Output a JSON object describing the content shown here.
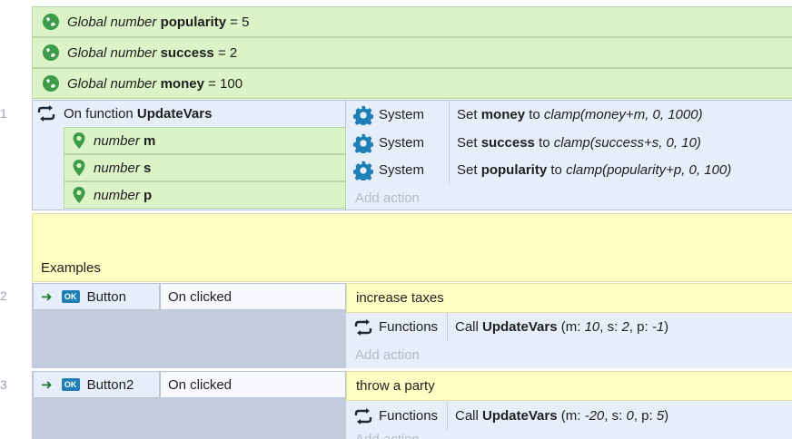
{
  "globals": [
    {
      "prefix": "Global number",
      "name": "popularity",
      "value": "= 5"
    },
    {
      "prefix": "Global number",
      "name": "success",
      "value": "= 2"
    },
    {
      "prefix": "Global number",
      "name": "money",
      "value": "= 100"
    }
  ],
  "line_numbers": [
    "1",
    "2",
    "3"
  ],
  "function_block": {
    "keyword": "On function",
    "name": "UpdateVars",
    "params": [
      {
        "type": "number",
        "name": "m"
      },
      {
        "type": "number",
        "name": "s"
      },
      {
        "type": "number",
        "name": "p"
      }
    ],
    "actions": [
      {
        "object": "System",
        "verb": "Set",
        "var": "money",
        "to": "to",
        "expr": "clamp(money+m, 0, 1000)"
      },
      {
        "object": "System",
        "verb": "Set",
        "var": "success",
        "to": "to",
        "expr": "clamp(success+s, 0, 10)"
      },
      {
        "object": "System",
        "verb": "Set",
        "var": "popularity",
        "to": "to",
        "expr": "clamp(popularity+p, 0, 100)"
      }
    ],
    "add_action": "Add action"
  },
  "comment_examples": "Examples",
  "events": [
    {
      "object": "Button",
      "trigger": "On clicked",
      "comment": "increase taxes",
      "action": {
        "object": "Functions",
        "call": "Call",
        "fn": "UpdateVars",
        "open": "(m:",
        "m": "10",
        "s_label": ", s:",
        "s": "2",
        "p_label": ", p:",
        "p": "-1",
        "close": ")"
      },
      "add_action": "Add action"
    },
    {
      "object": "Button2",
      "trigger": "On clicked",
      "comment": "throw a party",
      "action": {
        "object": "Functions",
        "call": "Call",
        "fn": "UpdateVars",
        "open": "(m:",
        "m": "-20",
        "s_label": ", s:",
        "s": "0",
        "p_label": ", p:",
        "p": "5",
        "close": ")"
      },
      "add_action": "Add action"
    }
  ],
  "colors": {
    "global_bg": "#dcf2c7",
    "event_bg": "#e6eef9",
    "comment_bg": "#ffffc4",
    "gear_blue": "#1d7fb5",
    "globe_green": "#3d9b4a"
  },
  "icons": [
    "globe-icon",
    "loop-arrows-icon",
    "location-pin-icon",
    "gear-icon",
    "arrow-right-icon",
    "ok-button-icon"
  ]
}
